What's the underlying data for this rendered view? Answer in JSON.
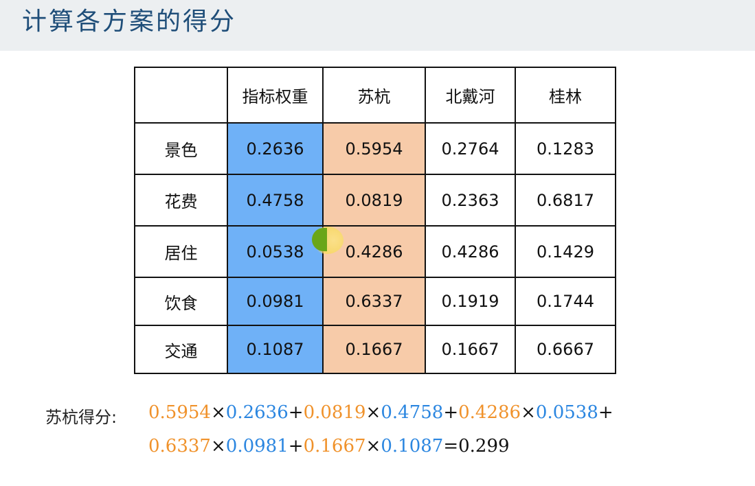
{
  "title": "计算各方案的得分",
  "table": {
    "headers": [
      "",
      "指标权重",
      "苏杭",
      "北戴河",
      "桂林"
    ],
    "rows": [
      {
        "label": "景色",
        "weight": "0.2636",
        "suhang": "0.5954",
        "beidaihe": "0.2764",
        "guilin": "0.1283"
      },
      {
        "label": "花费",
        "weight": "0.4758",
        "suhang": "0.0819",
        "beidaihe": "0.2363",
        "guilin": "0.6817"
      },
      {
        "label": "居住",
        "weight": "0.0538",
        "suhang": "0.4286",
        "beidaihe": "0.4286",
        "guilin": "0.1429"
      },
      {
        "label": "饮食",
        "weight": "0.0981",
        "suhang": "0.6337",
        "beidaihe": "0.1919",
        "guilin": "0.1744"
      },
      {
        "label": "交通",
        "weight": "0.1087",
        "suhang": "0.1667",
        "beidaihe": "0.1667",
        "guilin": "0.6667"
      }
    ]
  },
  "formula": {
    "label": "苏杭得分:",
    "times": "×",
    "plus": "+",
    "equals": "=",
    "result": "0.299",
    "terms": [
      {
        "score": "0.5954",
        "weight": "0.2636"
      },
      {
        "score": "0.0819",
        "weight": "0.4758"
      },
      {
        "score": "0.4286",
        "weight": "0.0538"
      },
      {
        "score": "0.6337",
        "weight": "0.0981"
      },
      {
        "score": "0.1667",
        "weight": "0.1087"
      }
    ]
  },
  "colors": {
    "weight_column": "#6fb1f7",
    "suhang_column": "#f7cba9",
    "score_text": "#f0922b",
    "weight_text": "#2b86e0",
    "title_text": "#1f4e79"
  }
}
